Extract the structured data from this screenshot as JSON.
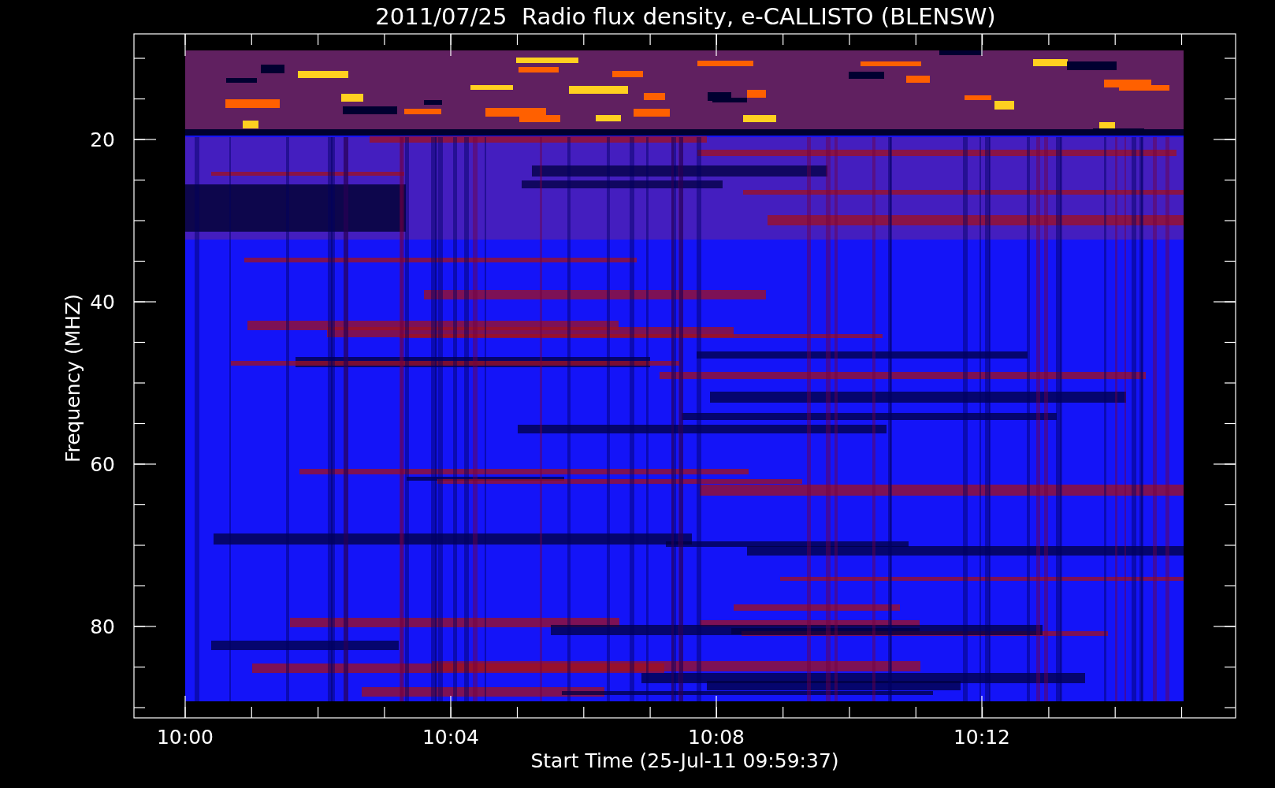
{
  "title": "2011/07/25  Radio flux density, e-CALLISTO (BLENSW)",
  "y_axis": {
    "label": "Frequency (MHZ)",
    "ticks": [
      "20",
      "40",
      "60",
      "80"
    ]
  },
  "x_axis": {
    "label": "Start Time (25-Jul-11 09:59:37)",
    "ticks": [
      "10:00",
      "10:04",
      "10:08",
      "10:12"
    ]
  }
}
